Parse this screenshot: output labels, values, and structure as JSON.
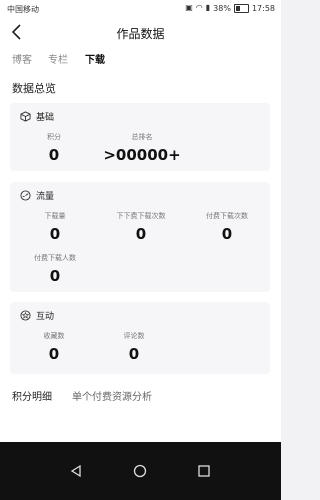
{
  "status_bar": {
    "carrier": "中国移动",
    "battery": "38%",
    "time": "17:58"
  },
  "nav": {
    "title": "作品数据",
    "back_icon": "back-arrow-icon"
  },
  "tabs": [
    {
      "label": "博客",
      "active": false
    },
    {
      "label": "专栏",
      "active": false
    },
    {
      "label": "下载",
      "active": true
    }
  ],
  "overview": {
    "title": "数据总览"
  },
  "basic": {
    "title": "基础",
    "icon": "cube-icon",
    "metrics": [
      {
        "label": "积分",
        "value": "0"
      },
      {
        "label": "总排名",
        "value": ">00000+"
      }
    ]
  },
  "traffic": {
    "title": "流量",
    "icon": "speedometer-icon",
    "metrics": [
      {
        "label": "下载量",
        "value": "0"
      },
      {
        "label": "下下费下载次数",
        "value": "0"
      },
      {
        "label": "付费下载次数",
        "value": "0"
      },
      {
        "label": "付费下载人数",
        "value": "0"
      }
    ]
  },
  "interact": {
    "title": "互动",
    "icon": "star-badge-icon",
    "metrics": [
      {
        "label": "收藏数",
        "value": "0"
      },
      {
        "label": "评论数",
        "value": "0"
      }
    ]
  },
  "bottom": {
    "left": "积分明细",
    "right": "单个付费资源分析"
  },
  "system_nav": [
    "back-triangle-icon",
    "home-circle-icon",
    "recent-square-icon"
  ]
}
